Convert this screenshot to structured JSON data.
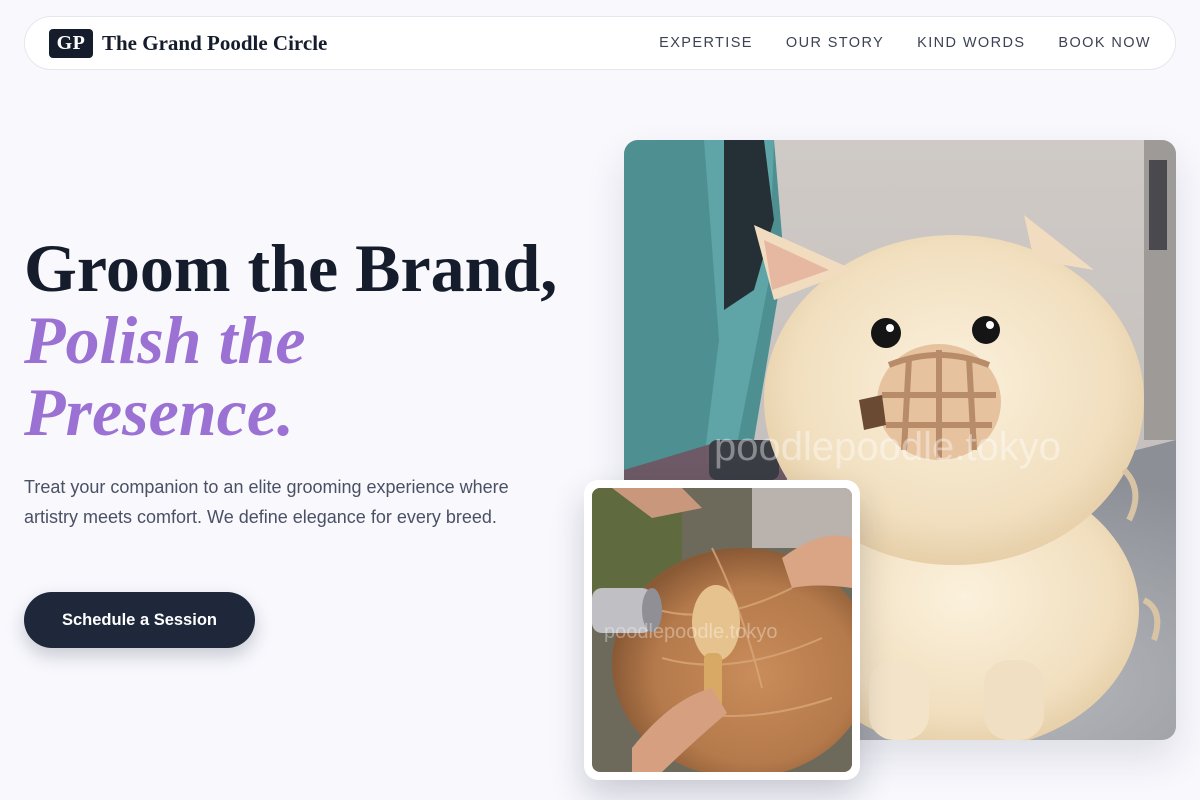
{
  "nav": {
    "logo_mark": "GP",
    "brand_name": "The Grand Poodle Circle",
    "links": [
      "EXPERTISE",
      "OUR STORY",
      "KIND WORDS",
      "BOOK NOW"
    ]
  },
  "hero": {
    "headline_line1": "Groom the Brand,",
    "headline_accent1": "Polish the",
    "headline_accent2": "Presence.",
    "description": "Treat your companion to an elite grooming experience where artistry meets comfort. We define elegance for every breed.",
    "cta_label": "Schedule a Session"
  },
  "images": {
    "main_watermark": "poodlepoodle.tokyo",
    "card_watermark": "poodlepoodle.tokyo"
  },
  "colors": {
    "accent": "#9b72d4",
    "dark": "#151c2c",
    "cta": "#1f273a",
    "background": "#f8f8fd"
  }
}
